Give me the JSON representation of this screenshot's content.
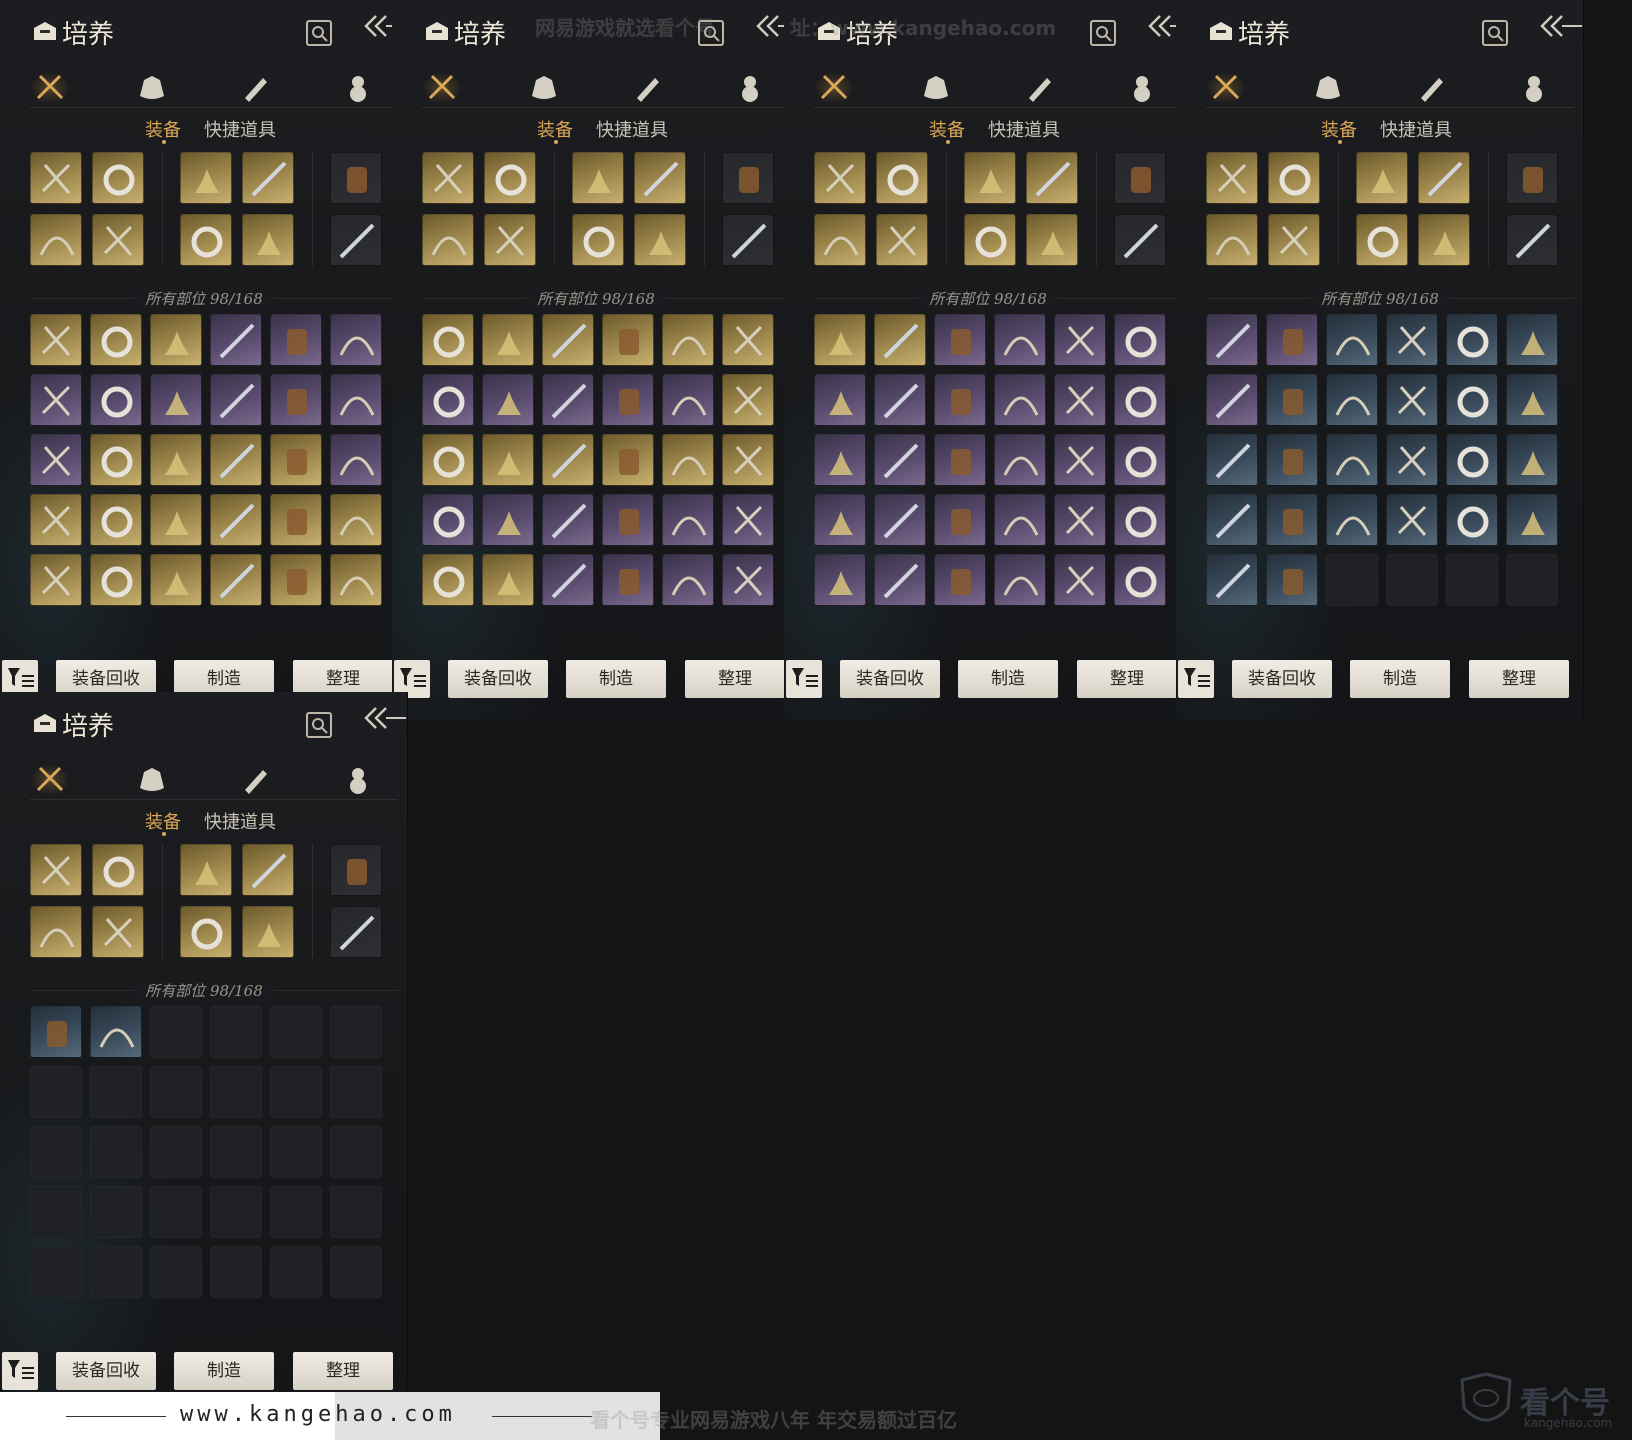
{
  "app": {
    "title": "培养",
    "category_tabs": [
      "weapon-crossed-swords-icon",
      "pouch-icon",
      "scroll-icon",
      "gem-icon"
    ],
    "sub_tabs": [
      "装备",
      "快捷道具"
    ],
    "capacity_label": "所有部位 98/168",
    "buttons": {
      "recycle": "装备回收",
      "craft": "制造",
      "sort": "整理"
    }
  },
  "colors": {
    "accent": "#d9a758",
    "gold_item": "#a08a4e",
    "purple_item": "#5a4c6f",
    "blue_item": "#3a4b5b"
  },
  "panels": [
    {
      "equipped": [
        "gold",
        "gold",
        "gold",
        "gold",
        "dark",
        "gold",
        "gold",
        "gold",
        "gold",
        "dark"
      ],
      "inventory": [
        "gold",
        "gold",
        "gold",
        "purple",
        "purple",
        "purple",
        "purple",
        "purple",
        "purple",
        "purple",
        "purple",
        "purple",
        "purple",
        "gold",
        "gold",
        "gold",
        "gold",
        "purple",
        "gold",
        "gold",
        "gold",
        "gold",
        "gold",
        "gold",
        "gold",
        "gold",
        "gold",
        "gold",
        "gold",
        "gold"
      ]
    },
    {
      "equipped": [
        "gold",
        "gold",
        "gold",
        "gold",
        "dark",
        "gold",
        "gold",
        "gold",
        "gold",
        "dark"
      ],
      "inventory": [
        "gold",
        "gold",
        "gold",
        "gold",
        "gold",
        "gold",
        "purple",
        "purple",
        "purple",
        "purple",
        "purple",
        "gold",
        "gold",
        "gold",
        "gold",
        "gold",
        "gold",
        "gold",
        "purple",
        "purple",
        "purple",
        "purple",
        "purple",
        "purple",
        "gold",
        "gold",
        "purple",
        "purple",
        "purple",
        "purple"
      ]
    },
    {
      "equipped": [
        "gold",
        "gold",
        "gold",
        "gold",
        "dark",
        "gold",
        "gold",
        "gold",
        "gold",
        "dark"
      ],
      "inventory": [
        "gold",
        "gold",
        "purple",
        "purple",
        "purple",
        "purple",
        "purple",
        "purple",
        "purple",
        "purple",
        "purple",
        "purple",
        "purple",
        "purple",
        "purple",
        "purple",
        "purple",
        "purple",
        "purple",
        "purple",
        "purple",
        "purple",
        "purple",
        "purple",
        "purple",
        "purple",
        "purple",
        "purple",
        "purple",
        "purple"
      ]
    },
    {
      "equipped": [
        "gold",
        "gold",
        "gold",
        "gold",
        "dark",
        "gold",
        "gold",
        "gold",
        "gold",
        "dark"
      ],
      "inventory": [
        "purple",
        "purple",
        "blue",
        "blue",
        "blue",
        "blue",
        "purple",
        "blue",
        "blue",
        "blue",
        "blue",
        "blue",
        "blue",
        "blue",
        "blue",
        "blue",
        "blue",
        "blue",
        "blue",
        "blue",
        "blue",
        "blue",
        "blue",
        "blue",
        "blue",
        "blue",
        "empty",
        "empty",
        "empty",
        "empty"
      ]
    },
    {
      "equipped": [
        "gold",
        "gold",
        "gold",
        "gold",
        "dark",
        "gold",
        "gold",
        "gold",
        "gold",
        "dark"
      ],
      "inventory": [
        "blue",
        "blue",
        "empty",
        "empty",
        "empty",
        "empty",
        "empty",
        "empty",
        "empty",
        "empty",
        "empty",
        "empty",
        "empty",
        "empty",
        "empty",
        "empty",
        "empty",
        "empty",
        "empty",
        "empty",
        "empty",
        "empty",
        "empty",
        "empty",
        "empty",
        "empty",
        "empty",
        "empty",
        "empty",
        "empty"
      ]
    }
  ],
  "watermarks": {
    "top_left": "网易游戏就选看个号",
    "top_right": "址：www.kangehao.com",
    "footer_url": "www.kangehao.com",
    "footer_slogan": "看个号专业网易游戏八年   年交易额过百亿",
    "brand_name": "看个号",
    "brand_url": "kangehao.com"
  }
}
